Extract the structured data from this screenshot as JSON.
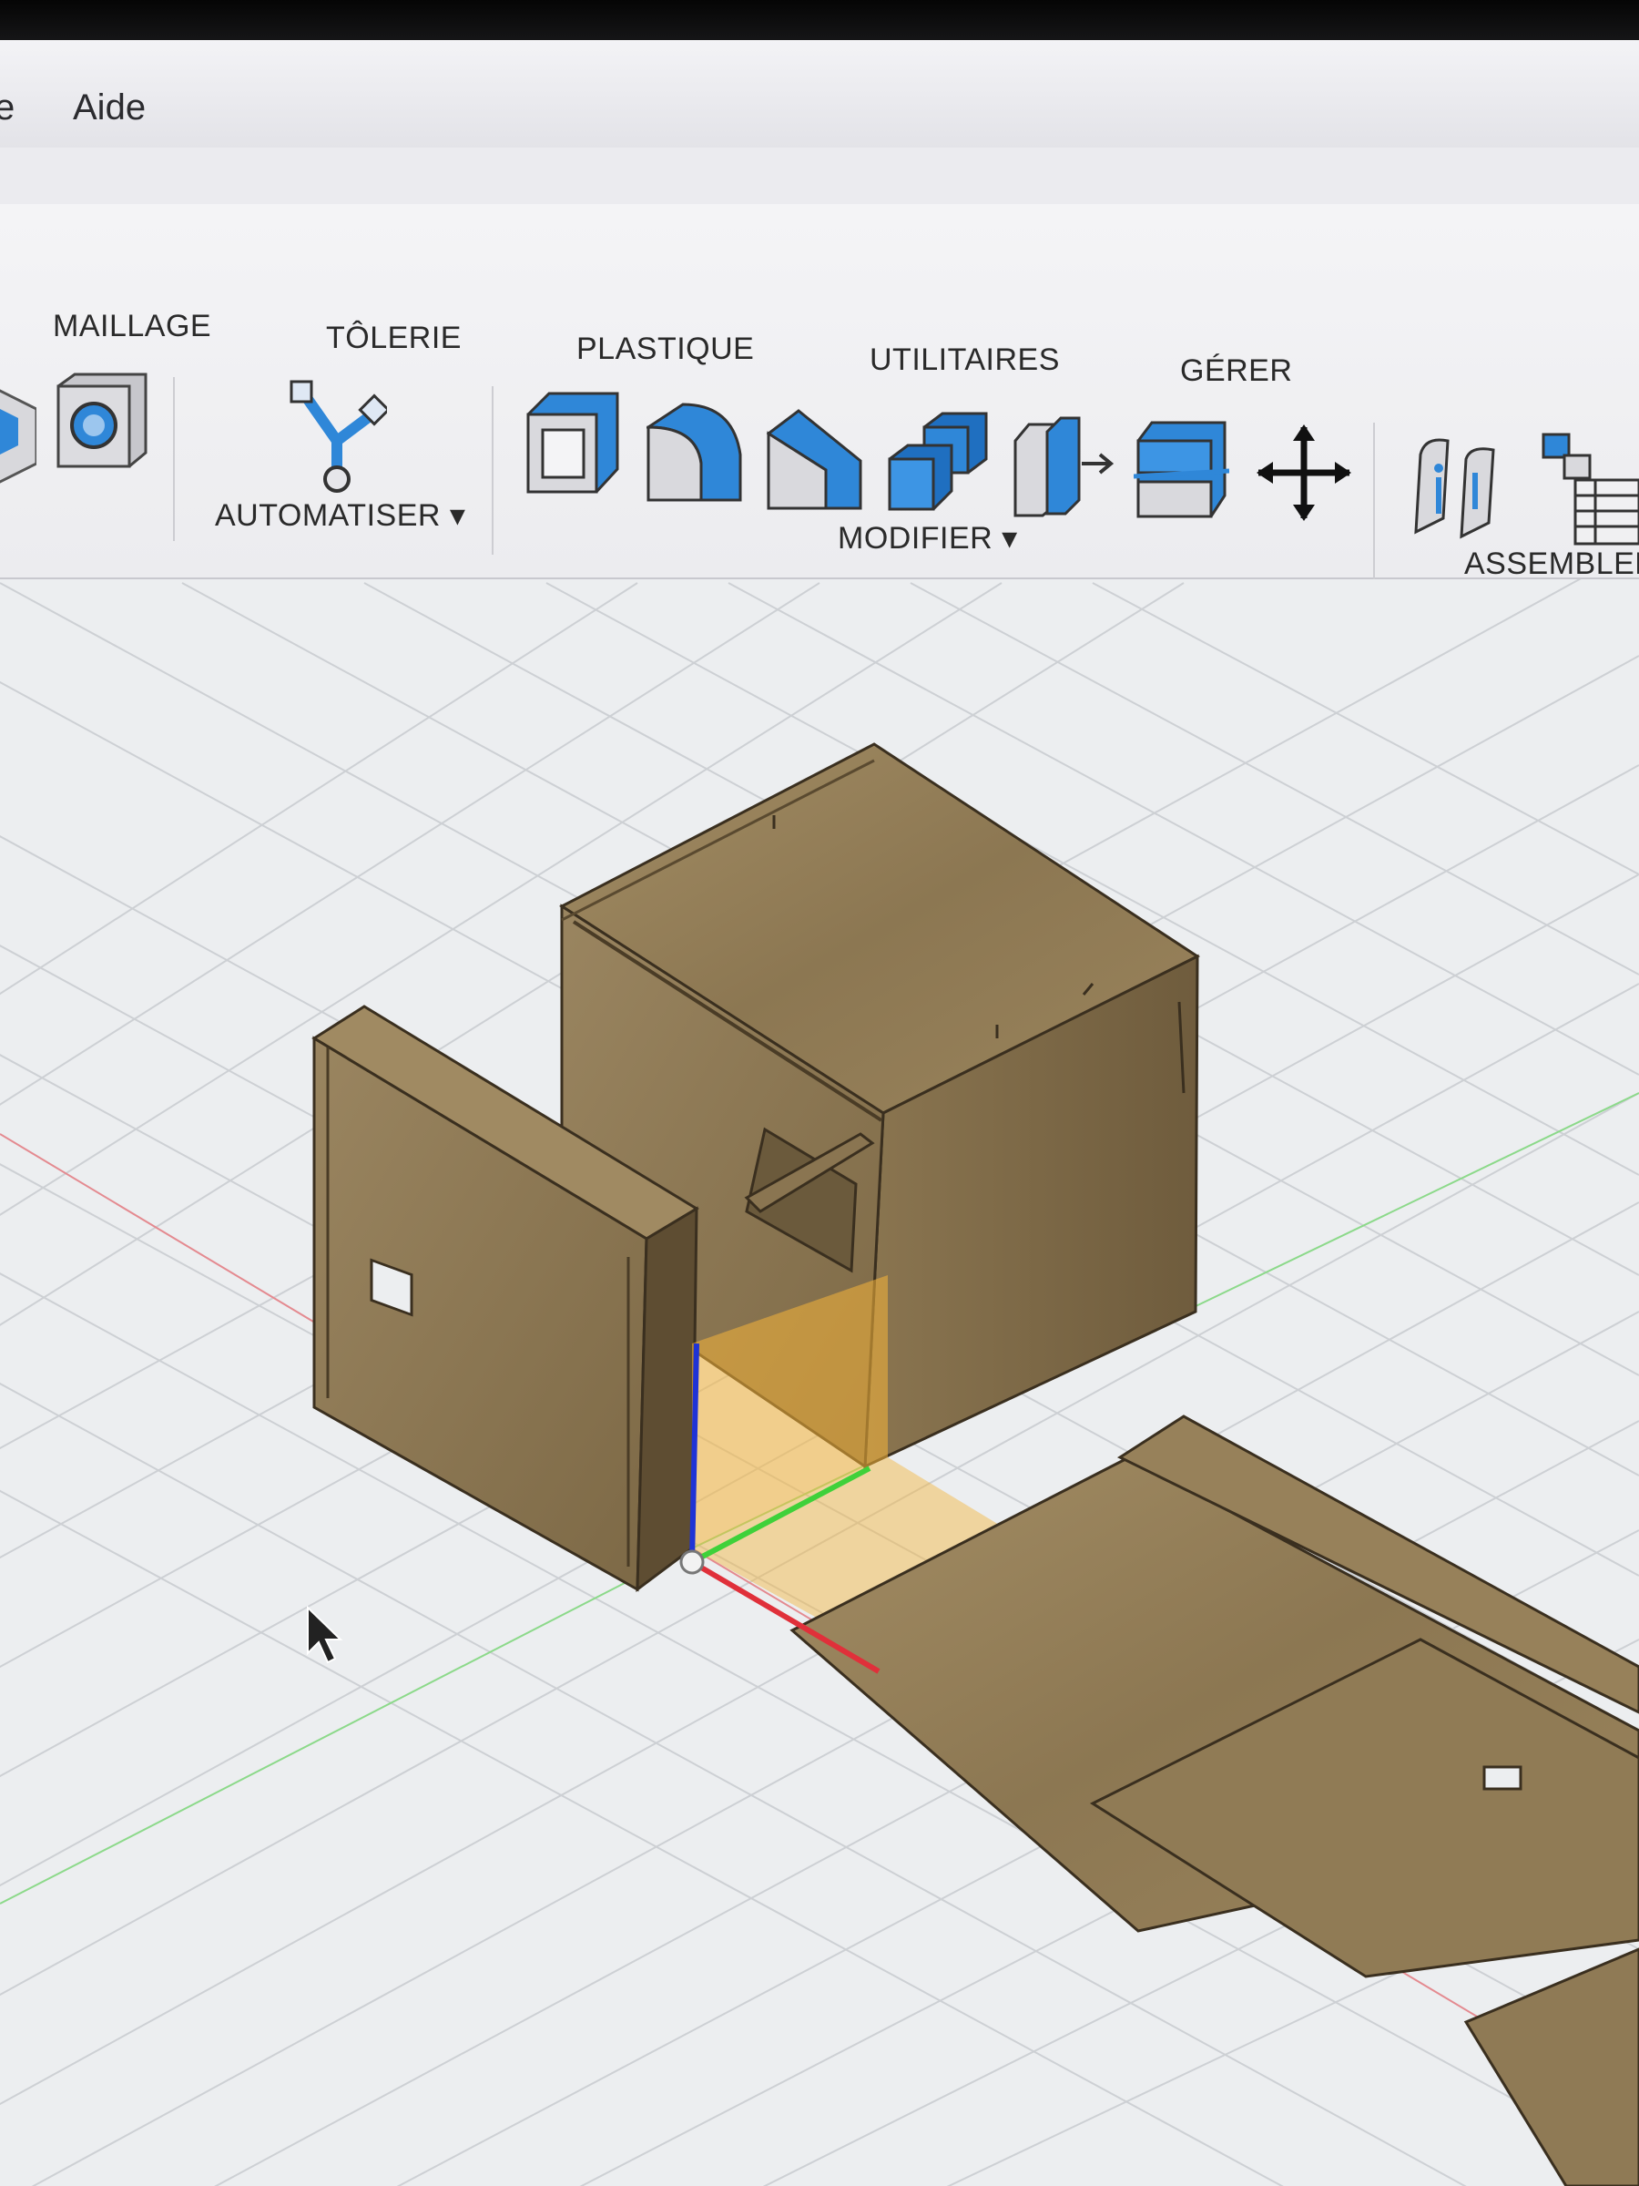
{
  "menubar": {
    "items": [
      {
        "label": "e"
      },
      {
        "label": "Aide"
      }
    ]
  },
  "ribbon": {
    "tabs": [
      {
        "label": "MAILLAGE"
      },
      {
        "label": "TÔLERIE"
      },
      {
        "label": "PLASTIQUE"
      },
      {
        "label": "UTILITAIRES"
      },
      {
        "label": "GÉRER"
      }
    ],
    "groups": {
      "automate": "AUTOMATISER ▾",
      "modify": "MODIFIER ▾",
      "assemble": "ASSEMBLER"
    },
    "tools": [
      {
        "icon": "solid-sphere-icon"
      },
      {
        "icon": "hole-cube-icon"
      },
      {
        "icon": "automate-node-icon"
      },
      {
        "icon": "shell-icon"
      },
      {
        "icon": "fillet-icon"
      },
      {
        "icon": "chamfer-icon"
      },
      {
        "icon": "combine-icon"
      },
      {
        "icon": "offset-face-icon"
      },
      {
        "icon": "split-body-icon"
      },
      {
        "icon": "move-icon"
      },
      {
        "icon": "joint-icon"
      },
      {
        "icon": "bill-of-materials-icon"
      }
    ]
  },
  "colors": {
    "accent_blue": "#2f87d8",
    "wood_light": "#9b8660",
    "wood_dark": "#6e5c3e",
    "axis_x": "#e0303a",
    "axis_y": "#3fd13a",
    "axis_z": "#1f33d6",
    "selection_plane": "#f5b43a"
  }
}
